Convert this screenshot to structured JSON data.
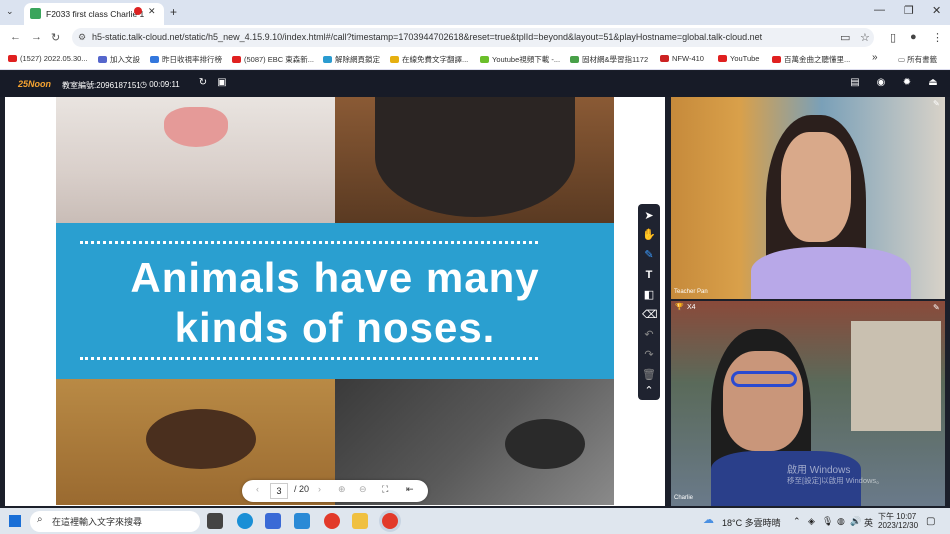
{
  "browser": {
    "tab_title": "F2033 first class Charlie 1",
    "url": "h5-static.talk-cloud.net/static/h5_new_4.15.9.10/index.html#/call?timestamp=1703944702618&reset=true&tplId=beyond&layout=51&playHostname=global.talk-cloud.net",
    "bookmarks": [
      "(1527) 2022.05.30...",
      "加入文設",
      "昨日收視率排行榜",
      "(5087) EBC 東森新...",
      "解除網頁鎖定",
      "在線免費文字翻譯...",
      "Youtube視頻下載 -...",
      "固材網&學習指1172",
      "NFW-410",
      "YouTube",
      "百萬金曲之聽懂里..."
    ],
    "all_bookmarks": "所有書籤"
  },
  "classroom": {
    "logo": "25Noon",
    "room_id": "教室編號:2096187151",
    "timer": "00:09:11"
  },
  "slide": {
    "headline_line1": "Animals have many",
    "headline_line2": "kinds of noses.",
    "accent_color": "#2a9fd0"
  },
  "pager": {
    "current_page": "3",
    "total_pages": "/ 20"
  },
  "video": {
    "teacher_label": "Teacher Pan",
    "student_label": "Charlie",
    "student_badge": "X4",
    "watermark_line1": "啟用 Windows",
    "watermark_line2": "移至[設定]以啟用 Windows。"
  },
  "taskbar": {
    "search_placeholder": "在這裡輸入文字來搜尋",
    "weather": "18°C 多雲時晴",
    "ime": "英",
    "time": "下午 10:07",
    "date": "2023/12/30"
  }
}
